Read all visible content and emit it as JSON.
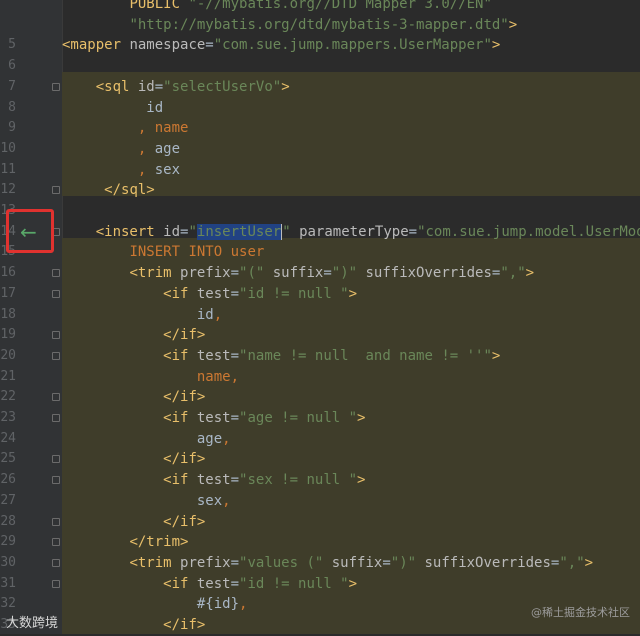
{
  "lines": [
    {
      "n": "",
      "parts": [
        [
          "txt",
          "        "
        ],
        [
          "tag",
          "PUBLIC "
        ],
        [
          "val",
          "\"-//mybatis.org//DTD Mapper 3.0//EN\""
        ]
      ]
    },
    {
      "n": "",
      "parts": [
        [
          "txt",
          "        "
        ],
        [
          "val",
          "\"http://mybatis.org/dtd/mybatis-3-mapper.dtd\""
        ],
        [
          "tag",
          ">"
        ]
      ]
    },
    {
      "n": "5",
      "parts": [
        [
          "tag",
          "<mapper "
        ],
        [
          "attr",
          "namespace"
        ],
        [
          "txt",
          "="
        ],
        [
          "val",
          "\"com.sue.jump.mappers.UserMapper\""
        ],
        [
          "tag",
          ">"
        ]
      ]
    },
    {
      "n": "6",
      "parts": []
    },
    {
      "n": "7",
      "parts": [
        [
          "txt",
          "    "
        ],
        [
          "tag",
          "<sql "
        ],
        [
          "attr",
          "id"
        ],
        [
          "txt",
          "="
        ],
        [
          "val",
          "\"selectUserVo\""
        ],
        [
          "tag",
          ">"
        ]
      ]
    },
    {
      "n": "8",
      "parts": [
        [
          "txt",
          "          id"
        ]
      ]
    },
    {
      "n": "9",
      "parts": [
        [
          "txt",
          "         "
        ],
        [
          "sql-kw",
          ", "
        ],
        [
          "sql-kw",
          "name"
        ]
      ]
    },
    {
      "n": "10",
      "parts": [
        [
          "txt",
          "         "
        ],
        [
          "sql-kw",
          ", "
        ],
        [
          "txt",
          "age"
        ]
      ]
    },
    {
      "n": "11",
      "parts": [
        [
          "txt",
          "         "
        ],
        [
          "sql-kw",
          ", "
        ],
        [
          "txt",
          "sex"
        ]
      ]
    },
    {
      "n": "12",
      "parts": [
        [
          "txt",
          "     "
        ],
        [
          "tag",
          "</sql>"
        ]
      ]
    },
    {
      "n": "13",
      "parts": []
    },
    {
      "n": "14",
      "parts": [
        [
          "txt",
          "    "
        ],
        [
          "tag",
          "<insert "
        ],
        [
          "attr",
          "id"
        ],
        [
          "txt",
          "="
        ],
        [
          "val",
          "\""
        ],
        [
          "sel",
          "insertUser"
        ],
        [
          "caret",
          ""
        ],
        [
          "val",
          "\""
        ],
        [
          "txt",
          " "
        ],
        [
          "attr",
          "parameterType"
        ],
        [
          "txt",
          "="
        ],
        [
          "val",
          "\"com.sue.jump.model.UserModel\""
        ]
      ]
    },
    {
      "n": "15",
      "parts": [
        [
          "txt",
          "        "
        ],
        [
          "sql-kw",
          "INSERT INTO "
        ],
        [
          "sql-kw",
          "user"
        ]
      ]
    },
    {
      "n": "16",
      "parts": [
        [
          "txt",
          "        "
        ],
        [
          "tag",
          "<trim "
        ],
        [
          "attr",
          "prefix"
        ],
        [
          "txt",
          "="
        ],
        [
          "val",
          "\"(\" "
        ],
        [
          "attr",
          "suffix"
        ],
        [
          "txt",
          "="
        ],
        [
          "val",
          "\")\" "
        ],
        [
          "attr",
          "suffixOverrides"
        ],
        [
          "txt",
          "="
        ],
        [
          "val",
          "\",\""
        ],
        [
          "tag",
          ">"
        ]
      ]
    },
    {
      "n": "17",
      "parts": [
        [
          "txt",
          "            "
        ],
        [
          "tag",
          "<if "
        ],
        [
          "attr",
          "test"
        ],
        [
          "txt",
          "="
        ],
        [
          "val",
          "\"id != null \""
        ],
        [
          "tag",
          ">"
        ]
      ]
    },
    {
      "n": "18",
      "parts": [
        [
          "txt",
          "                id"
        ],
        [
          "sql-kw",
          ","
        ]
      ]
    },
    {
      "n": "19",
      "parts": [
        [
          "txt",
          "            "
        ],
        [
          "tag",
          "</if>"
        ]
      ]
    },
    {
      "n": "20",
      "parts": [
        [
          "txt",
          "            "
        ],
        [
          "tag",
          "<if "
        ],
        [
          "attr",
          "test"
        ],
        [
          "txt",
          "="
        ],
        [
          "val",
          "\"name != null  and name != ''\""
        ],
        [
          "tag",
          ">"
        ]
      ]
    },
    {
      "n": "21",
      "parts": [
        [
          "txt",
          "                "
        ],
        [
          "sql-kw",
          "name,"
        ]
      ]
    },
    {
      "n": "22",
      "parts": [
        [
          "txt",
          "            "
        ],
        [
          "tag",
          "</if>"
        ]
      ]
    },
    {
      "n": "23",
      "parts": [
        [
          "txt",
          "            "
        ],
        [
          "tag",
          "<if "
        ],
        [
          "attr",
          "test"
        ],
        [
          "txt",
          "="
        ],
        [
          "val",
          "\"age != null \""
        ],
        [
          "tag",
          ">"
        ]
      ]
    },
    {
      "n": "24",
      "parts": [
        [
          "txt",
          "                age"
        ],
        [
          "sql-kw",
          ","
        ]
      ]
    },
    {
      "n": "25",
      "parts": [
        [
          "txt",
          "            "
        ],
        [
          "tag",
          "</if>"
        ]
      ]
    },
    {
      "n": "26",
      "parts": [
        [
          "txt",
          "            "
        ],
        [
          "tag",
          "<if "
        ],
        [
          "attr",
          "test"
        ],
        [
          "txt",
          "="
        ],
        [
          "val",
          "\"sex != null \""
        ],
        [
          "tag",
          ">"
        ]
      ]
    },
    {
      "n": "27",
      "parts": [
        [
          "txt",
          "                sex"
        ],
        [
          "sql-kw",
          ","
        ]
      ]
    },
    {
      "n": "28",
      "parts": [
        [
          "txt",
          "            "
        ],
        [
          "tag",
          "</if>"
        ]
      ]
    },
    {
      "n": "29",
      "parts": [
        [
          "txt",
          "        "
        ],
        [
          "tag",
          "</trim>"
        ]
      ]
    },
    {
      "n": "30",
      "parts": [
        [
          "txt",
          "        "
        ],
        [
          "tag",
          "<trim "
        ],
        [
          "attr",
          "prefix"
        ],
        [
          "txt",
          "="
        ],
        [
          "val",
          "\"values (\" "
        ],
        [
          "attr",
          "suffix"
        ],
        [
          "txt",
          "="
        ],
        [
          "val",
          "\")\" "
        ],
        [
          "attr",
          "suffixOverrides"
        ],
        [
          "txt",
          "="
        ],
        [
          "val",
          "\",\""
        ],
        [
          "tag",
          ">"
        ]
      ]
    },
    {
      "n": "31",
      "parts": [
        [
          "txt",
          "            "
        ],
        [
          "tag",
          "<if "
        ],
        [
          "attr",
          "test"
        ],
        [
          "txt",
          "="
        ],
        [
          "val",
          "\"id != null \""
        ],
        [
          "tag",
          ">"
        ]
      ]
    },
    {
      "n": "32",
      "parts": [
        [
          "txt",
          "                #{id}"
        ],
        [
          "sql-kw",
          ","
        ]
      ]
    },
    {
      "n": "33",
      "parts": [
        [
          "txt",
          "            "
        ],
        [
          "tag",
          "</if>"
        ]
      ]
    }
  ],
  "watermark_left": "大数跨境",
  "watermark_right": "@稀土掘金技术社区",
  "icons": {
    "navigate": "arrow-left-icon"
  }
}
